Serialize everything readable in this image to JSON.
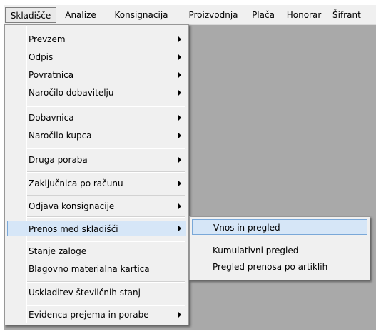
{
  "menubar": {
    "items": [
      {
        "label": "Skladišče",
        "active": true
      },
      {
        "label": "Analize"
      },
      {
        "label": "Konsignacija"
      },
      {
        "label": "Proizvodnja"
      },
      {
        "label": "Plača"
      },
      {
        "label": "Honorar",
        "underline_first": true
      },
      {
        "label": "Šifrant",
        "clipped": true
      }
    ]
  },
  "main_menu": {
    "items": [
      {
        "label": "Prevzem",
        "submenu": true
      },
      {
        "label": "Odpis",
        "submenu": true
      },
      {
        "label": "Povratnica",
        "submenu": true
      },
      {
        "label": "Naročilo dobavitelju",
        "submenu": true
      },
      {
        "label": "Dobavnica",
        "submenu": true
      },
      {
        "label": "Naročilo kupca",
        "submenu": true
      },
      {
        "label": "Druga poraba",
        "submenu": true
      },
      {
        "label": "Zaključnica po računu",
        "submenu": true
      },
      {
        "label": "Odjava konsignacije",
        "submenu": true
      },
      {
        "label": "Prenos med skladišči",
        "submenu": true,
        "highlighted": true
      },
      {
        "label": "Stanje zaloge",
        "submenu": false
      },
      {
        "label": "Blagovno materialna kartica",
        "submenu": false
      },
      {
        "label": "Uskladitev številčnih stanj",
        "submenu": false
      },
      {
        "label": "Evidenca prejema in porabe",
        "submenu": true
      }
    ]
  },
  "sub_menu": {
    "items": [
      {
        "label": "Vnos in pregled",
        "highlighted": true
      },
      {
        "label": "Kumulativni pregled"
      },
      {
        "label": "Pregled prenosa po artiklih"
      }
    ]
  },
  "colors": {
    "workspace": "#a9a9a9",
    "menu_bg": "#f0f0f0",
    "highlight_bg": "#d6e6f7",
    "highlight_border": "#7aa8d8"
  }
}
